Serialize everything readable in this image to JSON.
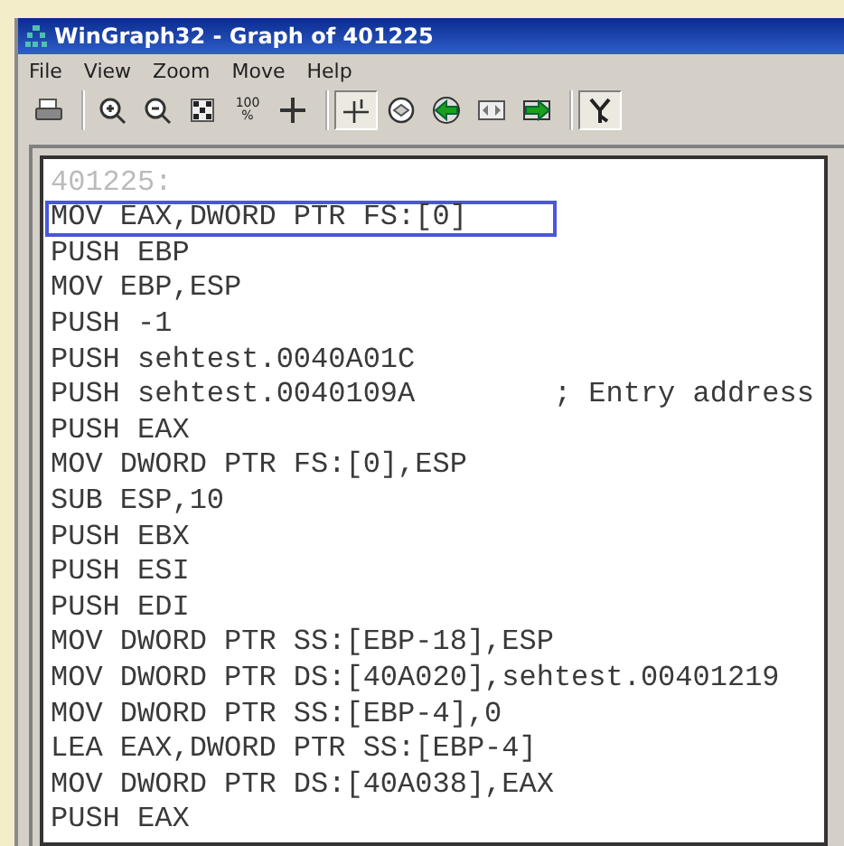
{
  "window": {
    "title": "WinGraph32 - Graph of 401225"
  },
  "menu": [
    "File",
    "View",
    "Zoom",
    "Move",
    "Help"
  ],
  "toolbar": [
    [
      {
        "kind": "print",
        "pressed": false
      }
    ],
    [
      {
        "kind": "zoom-in",
        "pressed": false
      },
      {
        "kind": "zoom-out",
        "pressed": false
      },
      {
        "kind": "fit",
        "pressed": false
      },
      {
        "kind": "percent",
        "label": "100 %",
        "pressed": false
      },
      {
        "kind": "move",
        "pressed": false
      }
    ],
    [
      {
        "kind": "node",
        "pressed": true
      },
      {
        "kind": "circle",
        "pressed": false
      },
      {
        "kind": "green-left",
        "pressed": false
      },
      {
        "kind": "arrows",
        "pressed": false
      },
      {
        "kind": "green-right",
        "pressed": false
      }
    ],
    [
      {
        "kind": "tree",
        "pressed": true
      }
    ]
  ],
  "graph": {
    "label": "401225:",
    "lines": [
      {
        "text": "MOV EAX,DWORD PTR FS:[0]",
        "selected": true
      },
      {
        "text": "PUSH EBP",
        "selected": false
      },
      {
        "text": "MOV EBP,ESP",
        "selected": false
      },
      {
        "text": "PUSH -1",
        "selected": false
      },
      {
        "text": "PUSH sehtest.0040A01C",
        "selected": false
      },
      {
        "text": "PUSH sehtest.0040109A",
        "comment": "; Entry address",
        "selected": false
      },
      {
        "text": "PUSH EAX",
        "selected": false
      },
      {
        "text": "MOV DWORD PTR FS:[0],ESP",
        "selected": false
      },
      {
        "text": "SUB ESP,10",
        "selected": false
      },
      {
        "text": "PUSH EBX",
        "selected": false
      },
      {
        "text": "PUSH ESI",
        "selected": false
      },
      {
        "text": "PUSH EDI",
        "selected": false
      },
      {
        "text": "MOV DWORD PTR SS:[EBP-18],ESP",
        "selected": false
      },
      {
        "text": "MOV DWORD PTR DS:[40A020],sehtest.00401219",
        "selected": false
      },
      {
        "text": "MOV DWORD PTR SS:[EBP-4],0",
        "selected": false
      },
      {
        "text": "LEA EAX,DWORD PTR SS:[EBP-4]",
        "selected": false
      },
      {
        "text": "MOV DWORD PTR DS:[40A038],EAX",
        "selected": false
      },
      {
        "text": "PUSH EAX",
        "selected": false
      }
    ]
  }
}
